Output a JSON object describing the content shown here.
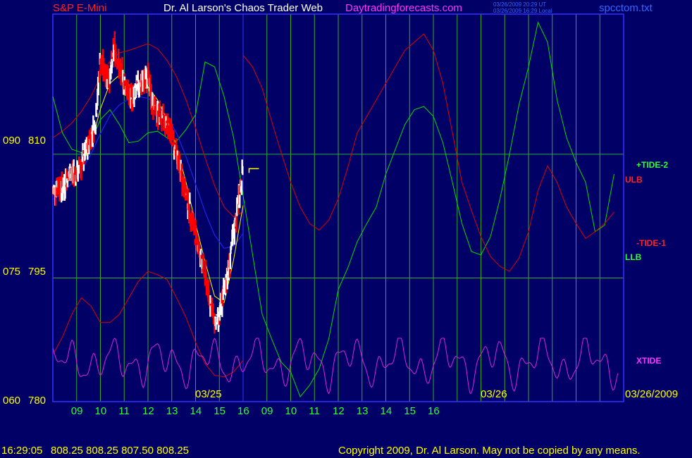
{
  "header": {
    "symbol": "S&P E-Mini",
    "title": "Dr. Al Larson's Chaos Trader Web",
    "site": "Daytradingforecasts.com",
    "time_ut": "03/26/2009 20:29 UT",
    "time_local": "03/26/2009 16:29 Local",
    "file": "spcctom.txt"
  },
  "status": {
    "clock": "16:29:05",
    "quote": "808.25 808.25 807.50 808.25",
    "copyright": "Copyright 2009, Dr. Al Larson. May not be copied by any means."
  },
  "colors": {
    "background": "#000066",
    "grid_v": "#33aa33",
    "grid_h": "#33aa33",
    "frame": "#3333ff",
    "price_up": "#ffffff",
    "price_down": "#ff0000",
    "ma_fast": "#ffff00",
    "ma_slow": "#2222ee",
    "tide": "#00dd00",
    "band": "#dd0000",
    "xtide": "#dd22dd",
    "label_yellow": "#ffff00",
    "label_green": "#33ff33",
    "label_red": "#ff2222",
    "label_magenta": "#ff33ff",
    "title_white": "#ffffff"
  },
  "chart_data": {
    "type": "line",
    "y_labels_left": [
      "090",
      "075",
      "060"
    ],
    "y_labels_price": [
      "810",
      "795",
      "780"
    ],
    "ylim_price": [
      780,
      827
    ],
    "x_ticks": [
      "09",
      "10",
      "11",
      "12",
      "13",
      "14",
      "15",
      "16",
      "09",
      "10",
      "11",
      "12",
      "13",
      "14",
      "15",
      "16"
    ],
    "date_labels": [
      "03/25",
      "03/26",
      "03/26/2009"
    ],
    "series_labels": {
      "tide2": "+TIDE-2",
      "ulb": "ULB",
      "tide1": "-TIDE-1",
      "llb": "LLB",
      "xtide": "XTIDE"
    },
    "price_bars": [
      [
        8.0,
        805.3
      ],
      [
        8.2,
        806.3
      ],
      [
        8.4,
        805.8
      ],
      [
        8.6,
        807.0
      ],
      [
        8.8,
        807.8
      ],
      [
        9.0,
        807.6
      ],
      [
        9.2,
        808.8
      ],
      [
        9.4,
        810.2
      ],
      [
        9.6,
        812.0
      ],
      [
        9.8,
        813.9
      ],
      [
        10.0,
        821.5
      ],
      [
        10.2,
        820.0
      ],
      [
        10.4,
        819.2
      ],
      [
        10.6,
        823.2
      ],
      [
        10.8,
        820.1
      ],
      [
        11.0,
        819.0
      ],
      [
        11.2,
        817.0
      ],
      [
        11.4,
        816.8
      ],
      [
        11.6,
        818.4
      ],
      [
        11.8,
        818.8
      ],
      [
        12.0,
        819.2
      ],
      [
        12.2,
        816.2
      ],
      [
        12.4,
        814.8
      ],
      [
        12.6,
        814.4
      ],
      [
        12.8,
        813.8
      ],
      [
        13.0,
        812.4
      ],
      [
        13.2,
        810.0
      ],
      [
        13.4,
        807.5
      ],
      [
        13.6,
        805.0
      ],
      [
        13.8,
        802.8
      ],
      [
        14.0,
        800.2
      ],
      [
        14.2,
        797.7
      ],
      [
        14.4,
        795.2
      ],
      [
        14.6,
        792.3
      ],
      [
        14.8,
        789.6
      ],
      [
        15.0,
        790.1
      ],
      [
        15.2,
        793.6
      ],
      [
        15.4,
        796.2
      ],
      [
        15.6,
        800.3
      ],
      [
        15.8,
        804.2
      ],
      [
        16.0,
        808.2
      ]
    ],
    "ma_fast": [
      [
        8.0,
        805.2
      ],
      [
        8.4,
        806.0
      ],
      [
        8.8,
        807.2
      ],
      [
        9.2,
        808.6
      ],
      [
        9.6,
        811.2
      ],
      [
        10.0,
        815.5
      ],
      [
        10.4,
        818.6
      ],
      [
        10.8,
        819.6
      ],
      [
        11.2,
        818.4
      ],
      [
        11.6,
        817.6
      ],
      [
        12.0,
        818.2
      ],
      [
        12.4,
        816.6
      ],
      [
        12.8,
        814.2
      ],
      [
        13.2,
        811.0
      ],
      [
        13.6,
        806.6
      ],
      [
        14.0,
        801.6
      ],
      [
        14.4,
        797.0
      ],
      [
        14.8,
        792.8
      ],
      [
        15.2,
        792.0
      ],
      [
        15.6,
        797.2
      ],
      [
        16.0,
        803.8
      ]
    ],
    "ma_slow": [
      [
        8.0,
        804.5
      ],
      [
        8.4,
        805.2
      ],
      [
        8.8,
        806.5
      ],
      [
        9.2,
        808.0
      ],
      [
        9.6,
        810.0
      ],
      [
        10.0,
        812.5
      ],
      [
        10.4,
        814.7
      ],
      [
        10.8,
        816.0
      ],
      [
        11.2,
        816.7
      ],
      [
        11.6,
        817.0
      ],
      [
        12.0,
        816.8
      ],
      [
        12.4,
        816.0
      ],
      [
        12.8,
        814.6
      ],
      [
        13.2,
        812.6
      ],
      [
        13.6,
        809.7
      ],
      [
        14.0,
        806.4
      ],
      [
        14.4,
        803.0
      ],
      [
        14.8,
        800.2
      ],
      [
        15.2,
        798.6
      ],
      [
        15.6,
        798.8
      ],
      [
        16.0,
        800.4
      ]
    ],
    "ulb": [
      [
        8.0,
        812.0
      ],
      [
        8.4,
        812.8
      ],
      [
        8.8,
        813.8
      ],
      [
        9.2,
        815.2
      ],
      [
        9.6,
        817.0
      ],
      [
        10.0,
        819.4
      ],
      [
        10.4,
        821.3
      ],
      [
        10.8,
        822.3
      ],
      [
        11.2,
        822.6
      ],
      [
        11.6,
        823.0
      ],
      [
        12.0,
        823.4
      ],
      [
        12.4,
        822.8
      ],
      [
        12.8,
        821.4
      ],
      [
        13.2,
        819.4
      ],
      [
        13.6,
        816.6
      ],
      [
        14.0,
        813.2
      ],
      [
        14.4,
        809.6
      ],
      [
        14.8,
        806.2
      ],
      [
        15.2,
        803.6
      ],
      [
        15.6,
        802.4
      ],
      [
        16.0,
        803.0
      ]
    ],
    "llb": [
      [
        8.0,
        785.7
      ],
      [
        8.4,
        787.8
      ],
      [
        8.8,
        790.6
      ],
      [
        9.2,
        792.6
      ],
      [
        9.6,
        791.6
      ],
      [
        10.0,
        789.6
      ],
      [
        10.4,
        789.6
      ],
      [
        10.8,
        790.6
      ],
      [
        11.2,
        792.6
      ],
      [
        11.6,
        794.6
      ],
      [
        12.0,
        795.8
      ],
      [
        12.4,
        795.4
      ],
      [
        12.8,
        794.8
      ],
      [
        13.2,
        792.6
      ],
      [
        13.6,
        790.2
      ],
      [
        14.0,
        787.2
      ],
      [
        14.4,
        784.6
      ],
      [
        14.8,
        783.2
      ],
      [
        15.2,
        783.0
      ],
      [
        15.6,
        783.6
      ],
      [
        16.0,
        785.0
      ]
    ],
    "tide2": [
      [
        8.0,
        817.0
      ],
      [
        8.4,
        812.6
      ],
      [
        8.8,
        810.6
      ],
      [
        9.2,
        810.2
      ],
      [
        9.6,
        811.6
      ],
      [
        10.0,
        814.2
      ],
      [
        10.4,
        815.4
      ],
      [
        10.8,
        813.6
      ],
      [
        11.2,
        811.4
      ],
      [
        11.6,
        811.6
      ],
      [
        12.0,
        812.6
      ],
      [
        12.4,
        812.8
      ],
      [
        12.8,
        812.0
      ],
      [
        13.2,
        811.6
      ],
      [
        13.6,
        813.0
      ],
      [
        14.0,
        814.8
      ],
      [
        14.4,
        821.2
      ],
      [
        14.8,
        820.6
      ],
      [
        15.2,
        817.0
      ],
      [
        15.6,
        812.0
      ],
      [
        16.0,
        805.0
      ],
      [
        16.4,
        797.8
      ],
      [
        16.8,
        790.6
      ],
      [
        17.2,
        787.6
      ],
      [
        17.6,
        784.8
      ],
      [
        18.0,
        783.6
      ],
      [
        18.4,
        780.6
      ],
      [
        18.8,
        782.0
      ],
      [
        19.2,
        784.0
      ],
      [
        19.6,
        787.6
      ],
      [
        20.0,
        793.6
      ],
      [
        20.4,
        796.2
      ],
      [
        20.8,
        799.4
      ],
      [
        21.2,
        801.6
      ],
      [
        21.6,
        803.6
      ],
      [
        22.0,
        807.6
      ],
      [
        22.4,
        810.6
      ],
      [
        22.8,
        813.6
      ],
      [
        23.2,
        815.4
      ],
      [
        23.6,
        815.8
      ],
      [
        24.0,
        814.6
      ],
      [
        24.4,
        811.4
      ],
      [
        24.8,
        806.6
      ],
      [
        25.2,
        801.6
      ],
      [
        25.6,
        798.2
      ],
      [
        26.0,
        797.8
      ],
      [
        26.4,
        800.0
      ],
      [
        26.8,
        804.6
      ],
      [
        27.2,
        810.0
      ],
      [
        27.6,
        816.0
      ],
      [
        28.0,
        820.6
      ],
      [
        28.4,
        826.0
      ],
      [
        28.8,
        823.6
      ],
      [
        29.2,
        816.6
      ],
      [
        29.6,
        812.0
      ],
      [
        30.0,
        809.0
      ],
      [
        30.4,
        806.6
      ],
      [
        30.8,
        800.6
      ],
      [
        31.2,
        801.4
      ],
      [
        31.6,
        807.6
      ]
    ],
    "tide1": [
      [
        16.0,
        822.0
      ],
      [
        16.4,
        820.6
      ],
      [
        16.8,
        818.0
      ],
      [
        17.2,
        814.0
      ],
      [
        17.6,
        810.2
      ],
      [
        18.0,
        806.6
      ],
      [
        18.4,
        803.6
      ],
      [
        18.8,
        801.6
      ],
      [
        19.2,
        800.8
      ],
      [
        19.6,
        802.0
      ],
      [
        20.0,
        804.6
      ],
      [
        20.4,
        808.4
      ],
      [
        20.8,
        812.6
      ],
      [
        21.2,
        814.6
      ],
      [
        21.6,
        816.6
      ],
      [
        22.0,
        818.6
      ],
      [
        22.4,
        820.6
      ],
      [
        22.8,
        822.6
      ],
      [
        23.2,
        823.6
      ],
      [
        23.6,
        824.6
      ],
      [
        24.0,
        822.6
      ],
      [
        24.4,
        818.6
      ],
      [
        24.8,
        812.6
      ],
      [
        25.2,
        806.6
      ],
      [
        25.6,
        803.2
      ],
      [
        26.0,
        800.0
      ],
      [
        26.4,
        797.6
      ],
      [
        26.8,
        796.4
      ],
      [
        27.2,
        795.8
      ],
      [
        27.6,
        797.4
      ],
      [
        28.0,
        800.6
      ],
      [
        28.4,
        805.6
      ],
      [
        28.8,
        808.6
      ],
      [
        29.2,
        806.6
      ],
      [
        29.6,
        803.6
      ],
      [
        30.0,
        801.6
      ],
      [
        30.4,
        799.8
      ],
      [
        30.8,
        800.6
      ],
      [
        31.2,
        801.6
      ],
      [
        31.6,
        803.0
      ]
    ]
  }
}
